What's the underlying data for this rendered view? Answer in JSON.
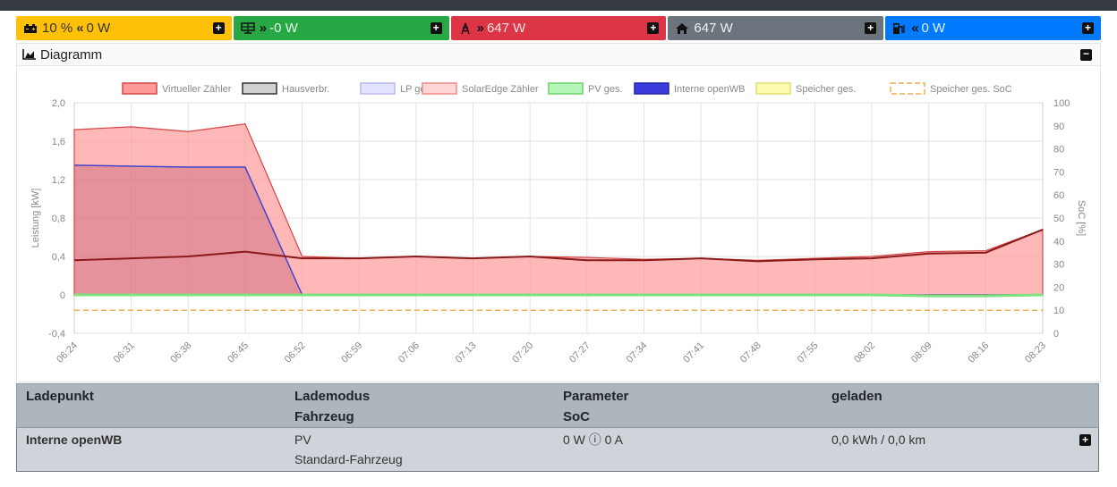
{
  "status_tiles": [
    {
      "icon": "battery-icon",
      "arrow": "",
      "value": "10 %",
      "arrow2": "«",
      "value2": "0 W",
      "color": "#ffc107"
    },
    {
      "icon": "grid-icon",
      "arrow": "»",
      "value": "-0 W",
      "color": "#28a745"
    },
    {
      "icon": "ev-charger-icon",
      "arrow": "»",
      "value": "647 W",
      "color": "#dc3545"
    },
    {
      "icon": "home-icon",
      "arrow": "",
      "value": "647 W",
      "color": "#6c757d"
    },
    {
      "icon": "ev-plug-icon",
      "arrow": "«",
      "value": "0 W",
      "color": "#007bff"
    }
  ],
  "diagram": {
    "title": "Diagramm",
    "icon": "area-chart-icon"
  },
  "chart_data": {
    "type": "area",
    "xlabel": "",
    "ylabel": "Leistung [kW]",
    "y2label": "SoC [%]",
    "ylim": [
      -0.4,
      2.0
    ],
    "y2lim": [
      0,
      100
    ],
    "yticks": [
      "2,0",
      "1,6",
      "1,2",
      "0,8",
      "0,4",
      "0",
      "-0,4"
    ],
    "y2ticks": [
      "100",
      "90",
      "80",
      "70",
      "60",
      "50",
      "40",
      "30",
      "20",
      "10",
      "0"
    ],
    "x": [
      "06:24",
      "06:31",
      "06:38",
      "06:45",
      "06:52",
      "06:59",
      "07:06",
      "07:13",
      "07:20",
      "07:27",
      "07:34",
      "07:41",
      "07:48",
      "07:55",
      "08:02",
      "08:09",
      "08:16",
      "08:23"
    ],
    "legend": [
      "Virtueller Zähler",
      "Hausverbr.",
      "LP ges.",
      "SolarEdge Zähler",
      "PV ges.",
      "Interne openWB",
      "Speicher ges.",
      "Speicher ges. SoC"
    ],
    "legend_position": "top",
    "grid": true,
    "series": [
      {
        "name": "Virtueller Zähler",
        "color": "#ff9a9a",
        "values": [
          1.72,
          1.75,
          1.7,
          1.78,
          0.4,
          0.38,
          0.4,
          0.38,
          0.4,
          0.39,
          0.37,
          0.38,
          0.36,
          0.38,
          0.4,
          0.45,
          0.46,
          0.68
        ]
      },
      {
        "name": "Hausverbr.",
        "color": "#8b1a1a",
        "values": [
          0.36,
          0.38,
          0.4,
          0.45,
          0.38,
          0.38,
          0.4,
          0.38,
          0.4,
          0.36,
          0.36,
          0.38,
          0.35,
          0.37,
          0.38,
          0.43,
          0.44,
          0.68
        ]
      },
      {
        "name": "Interne openWB",
        "color": "#4444cc",
        "values": [
          1.35,
          1.34,
          1.33,
          1.33,
          0.0,
          0.0,
          0.0,
          0.0,
          0.0,
          0.0,
          0.0,
          0.0,
          0.0,
          0.0,
          0.0,
          0.0,
          0.0,
          0.0
        ]
      },
      {
        "name": "PV ges.",
        "color": "#7ee07e",
        "values": [
          0,
          0,
          0,
          0,
          0,
          0,
          0,
          0,
          0,
          0,
          0,
          0,
          0,
          0,
          0,
          -0.01,
          -0.01,
          0
        ]
      },
      {
        "name": "Speicher ges. SoC",
        "color": "#f0ad4e",
        "values": [
          10,
          10,
          10,
          10,
          10,
          10,
          10,
          10,
          10,
          10,
          10,
          10,
          10,
          10,
          10,
          10,
          10,
          10
        ]
      }
    ]
  },
  "table": {
    "headers": {
      "ladepunkt": "Ladepunkt",
      "lademodus": "Lademodus",
      "fahrzeug": "Fahrzeug",
      "parameter": "Parameter",
      "soc": "SoC",
      "geladen": "geladen"
    },
    "rows": [
      {
        "ladepunkt": "Interne openWB",
        "lademodus": "PV",
        "fahrzeug": "Standard-Fahrzeug",
        "parameter": "0 W ⓘ 0 A",
        "geladen": "0,0 kWh / 0,0 km"
      }
    ]
  }
}
